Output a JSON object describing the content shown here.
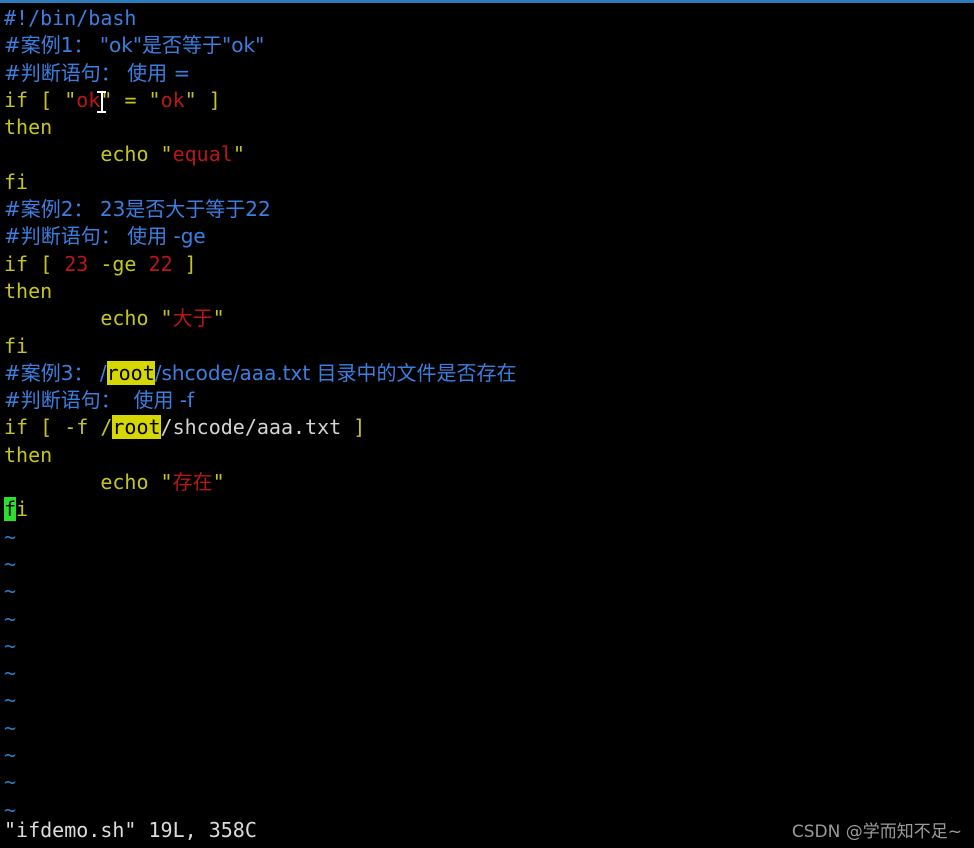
{
  "editor": {
    "name": "vim",
    "filename": "ifdemo.sh",
    "statusline": "\"ifdemo.sh\" 19L, 358C",
    "background": "#000000",
    "top_border_color": "#2b7bbd",
    "colors": {
      "comment": "#3b7fe0",
      "keyword": "#c5c522",
      "string": "#b81717",
      "number": "#b81717",
      "plain": "#d4d4d4",
      "search_highlight_bg": "#d6d600",
      "search_highlight_fg": "#000000",
      "cursor_bg": "#2ae02a",
      "tilde": "#2b7bbd",
      "statusline_fg": "#dcdcdc"
    },
    "tilde_char": "~",
    "tilde_count": 11,
    "search_term": "root",
    "cursor_char": "f"
  },
  "lines": [
    {
      "n": 1,
      "segments": [
        {
          "t": "#!/bin/bash",
          "c": "cmt"
        }
      ]
    },
    {
      "n": 2,
      "segments": [
        {
          "t": "#案例1： \"ok\"是否等于\"ok\"",
          "c": "cmt"
        }
      ]
    },
    {
      "n": 3,
      "segments": [
        {
          "t": "#判断语句： 使用 =",
          "c": "cmt"
        }
      ]
    },
    {
      "n": 4,
      "segments": [
        {
          "t": "if [ ",
          "c": "kw"
        },
        {
          "t": "\"",
          "c": "quote"
        },
        {
          "t": "ok",
          "c": "str"
        },
        {
          "t": "\"",
          "c": "quote"
        },
        {
          "t": " = ",
          "c": "kw"
        },
        {
          "t": "\"",
          "c": "quote"
        },
        {
          "t": "ok",
          "c": "str"
        },
        {
          "t": "\"",
          "c": "quote"
        },
        {
          "t": " ]",
          "c": "kw"
        }
      ]
    },
    {
      "n": 5,
      "segments": [
        {
          "t": "then",
          "c": "kw"
        }
      ]
    },
    {
      "n": 6,
      "segments": [
        {
          "t": "        echo ",
          "c": "kw"
        },
        {
          "t": "\"",
          "c": "quote"
        },
        {
          "t": "equal",
          "c": "str"
        },
        {
          "t": "\"",
          "c": "quote"
        }
      ]
    },
    {
      "n": 7,
      "segments": [
        {
          "t": "fi",
          "c": "kw"
        }
      ]
    },
    {
      "n": 8,
      "segments": [
        {
          "t": "#案例2： 23是否大于等于22",
          "c": "cmt"
        }
      ]
    },
    {
      "n": 9,
      "segments": [
        {
          "t": "#判断语句： 使用 -ge",
          "c": "cmt"
        }
      ]
    },
    {
      "n": 10,
      "segments": [
        {
          "t": "if [ ",
          "c": "kw"
        },
        {
          "t": "23",
          "c": "num"
        },
        {
          "t": " -ge ",
          "c": "kw"
        },
        {
          "t": "22",
          "c": "num"
        },
        {
          "t": " ]",
          "c": "kw"
        }
      ]
    },
    {
      "n": 11,
      "segments": [
        {
          "t": "then",
          "c": "kw"
        }
      ]
    },
    {
      "n": 12,
      "segments": [
        {
          "t": "        echo ",
          "c": "kw"
        },
        {
          "t": "\"",
          "c": "quote"
        },
        {
          "t": "大于",
          "c": "str"
        },
        {
          "t": "\"",
          "c": "quote"
        }
      ]
    },
    {
      "n": 13,
      "segments": [
        {
          "t": "fi",
          "c": "kw"
        }
      ]
    },
    {
      "n": 14,
      "segments": [
        {
          "t": "#案例3： /",
          "c": "cmt"
        },
        {
          "t": "root",
          "c": "hl"
        },
        {
          "t": "/shcode/aaa.txt 目录中的文件是否存在",
          "c": "cmt"
        }
      ]
    },
    {
      "n": 15,
      "segments": [
        {
          "t": "#判断语句：  使用 -f",
          "c": "cmt"
        }
      ]
    },
    {
      "n": 16,
      "segments": [
        {
          "t": "if [ -f /",
          "c": "kw"
        },
        {
          "t": "root",
          "c": "hl"
        },
        {
          "t": "/shcode/aaa.txt",
          "c": "plain"
        },
        {
          "t": " ]",
          "c": "kw"
        }
      ]
    },
    {
      "n": 17,
      "segments": [
        {
          "t": "then",
          "c": "kw"
        }
      ]
    },
    {
      "n": 18,
      "segments": [
        {
          "t": "        echo ",
          "c": "kw"
        },
        {
          "t": "\"",
          "c": "quote"
        },
        {
          "t": "存在",
          "c": "str"
        },
        {
          "t": "\"",
          "c": "quote"
        }
      ]
    },
    {
      "n": 19,
      "segments": [
        {
          "t": "f",
          "c": "cursor-block"
        },
        {
          "t": "i",
          "c": "kw"
        }
      ]
    }
  ],
  "watermark": "CSDN @学而知不足~"
}
